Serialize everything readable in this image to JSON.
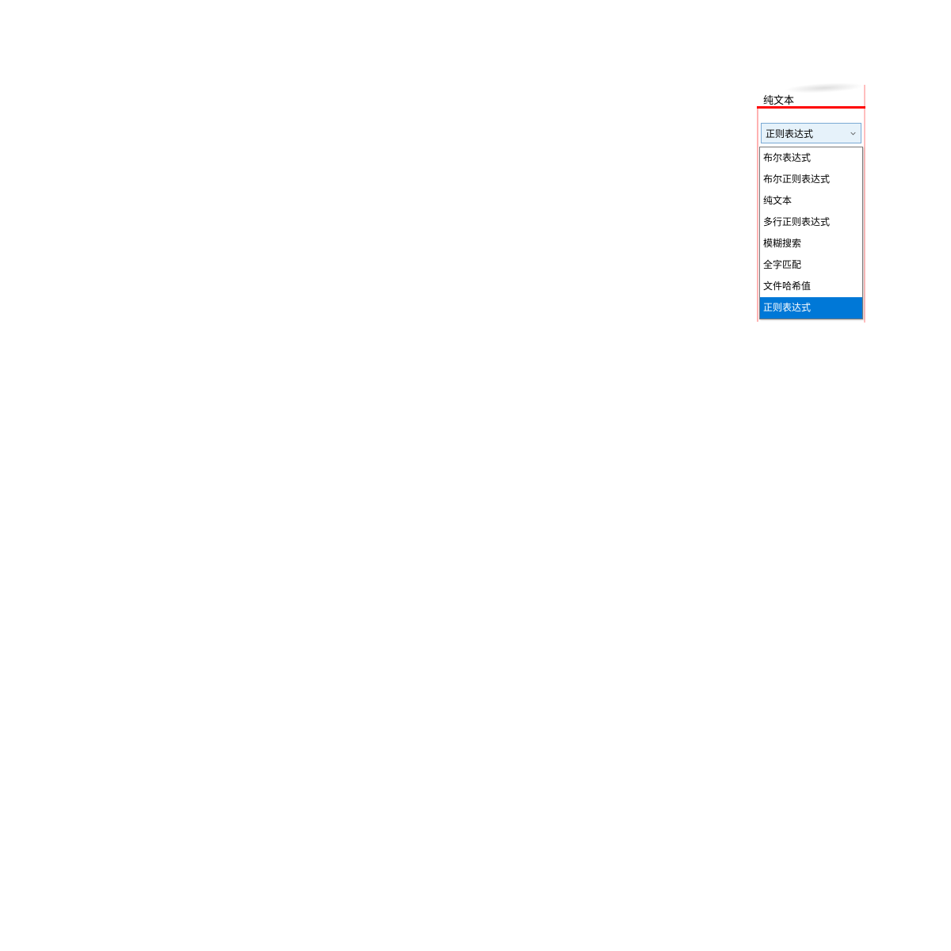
{
  "dropdown": {
    "header_label": "纯文本",
    "selected_value": "正则表达式",
    "options": [
      {
        "label": "布尔表达式",
        "selected": false
      },
      {
        "label": "布尔正则表达式",
        "selected": false
      },
      {
        "label": "纯文本",
        "selected": false
      },
      {
        "label": "多行正则表达式",
        "selected": false
      },
      {
        "label": "模糊搜索",
        "selected": false
      },
      {
        "label": "全字匹配",
        "selected": false
      },
      {
        "label": "文件哈希值",
        "selected": false
      },
      {
        "label": "正则表达式",
        "selected": true
      }
    ],
    "colors": {
      "highlight_border": "#ff0000",
      "selection_bg": "#0078d7",
      "combobox_bg": "#e6f2fa",
      "combobox_border": "#7aa9d4"
    }
  }
}
